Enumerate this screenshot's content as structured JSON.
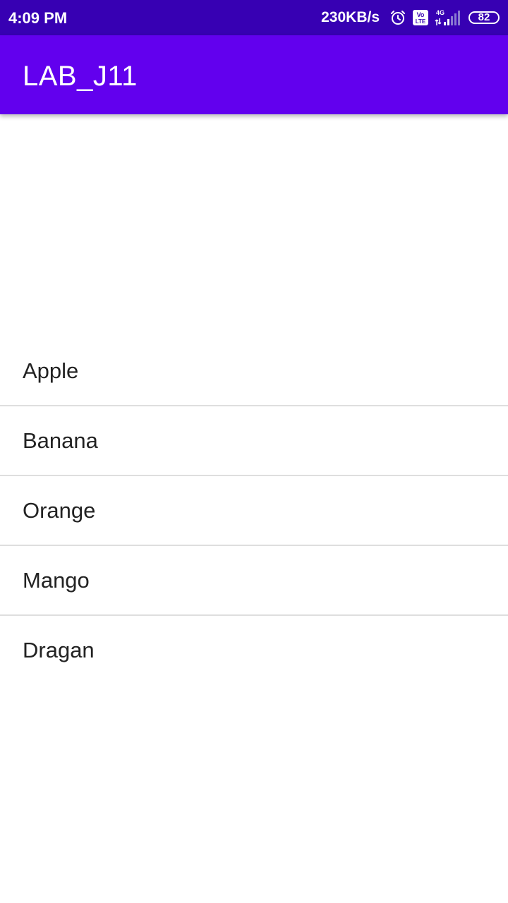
{
  "status_bar": {
    "time": "4:09 PM",
    "net_speed": "230KB/s",
    "icons": [
      "alarm-icon",
      "volte-icon",
      "4g-signal-icon"
    ],
    "network_type": "4G",
    "volte_label_top": "Vo",
    "volte_label_bottom": "LTE",
    "battery": "82"
  },
  "app_bar": {
    "title": "LAB_J11",
    "color": "#6200ee"
  },
  "list": {
    "items": [
      {
        "label": "Apple"
      },
      {
        "label": "Banana"
      },
      {
        "label": "Orange"
      },
      {
        "label": "Mango"
      },
      {
        "label": "Dragan"
      }
    ]
  },
  "colors": {
    "status_bar": "#3700b3",
    "app_bar": "#6200ee",
    "text": "#222222",
    "divider": "#dedede"
  }
}
